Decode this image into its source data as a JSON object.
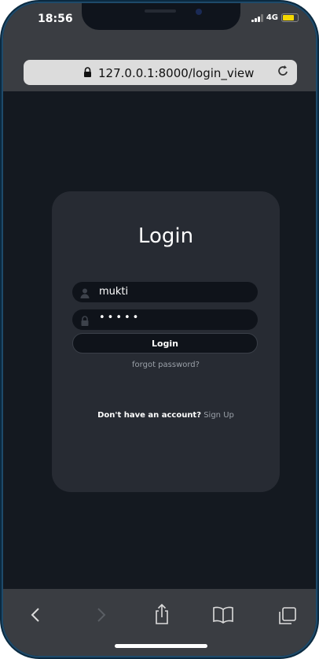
{
  "status_bar": {
    "time": "18:56",
    "network": "4G",
    "battery_level": 0.7,
    "battery_color": "#f5d800"
  },
  "browser": {
    "url": "127.0.0.1:8000/login_view",
    "lock_icon": "lock-icon",
    "reload_icon": "reload-icon"
  },
  "login_card": {
    "title": "Login",
    "username_value": "mukti",
    "password_value": "•••••",
    "login_button": "Login",
    "forgot_password": "forgot password?",
    "signup_prompt": "Don't have an account?",
    "signup_link": "Sign Up"
  },
  "toolbar": {
    "items": [
      "back-icon",
      "forward-icon",
      "share-icon",
      "bookmarks-icon",
      "tabs-icon"
    ]
  },
  "colors": {
    "page_bg": "#141920",
    "card_bg": "#272b33",
    "field_bg": "#0f131a",
    "chrome_bg": "#3a3d42",
    "frame_accent": "#1e4a6a"
  }
}
